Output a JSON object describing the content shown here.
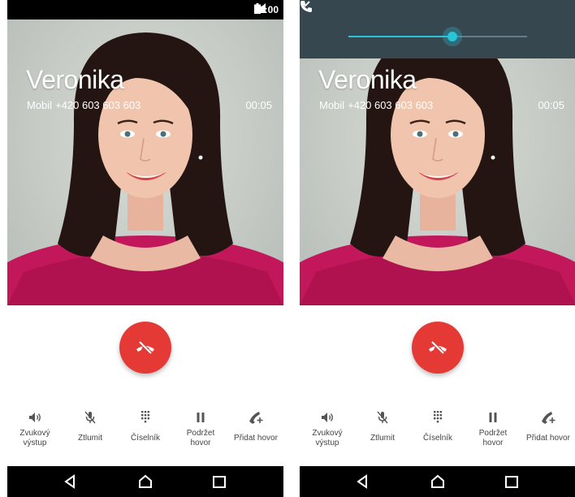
{
  "screens": [
    {
      "status_bar": {
        "time": "11:00"
      },
      "caller": {
        "name": "Veronika",
        "number_label": "Mobil",
        "number": "+420 603 603 603",
        "duration": "00:05"
      },
      "actions": [
        {
          "label_line1": "Zvukový",
          "label_line2": "výstup",
          "icon": "speaker-icon"
        },
        {
          "label_line1": "Ztlumit",
          "label_line2": "",
          "icon": "mic-off-icon"
        },
        {
          "label_line1": "Číselník",
          "label_line2": "",
          "icon": "dialpad-icon"
        },
        {
          "label_line1": "Podržet",
          "label_line2": "hovor",
          "icon": "pause-icon"
        },
        {
          "label_line1": "Přidat hovor",
          "label_line2": "",
          "icon": "add-call-icon"
        }
      ]
    },
    {
      "volume_panel": {
        "level": 0.58,
        "icon": "phone-icon",
        "expand_icon": "chevron-down-icon"
      },
      "caller": {
        "name": "Veronika",
        "number_label": "Mobil",
        "number": "+420 603 603 603",
        "duration": "00:05"
      },
      "actions": [
        {
          "label_line1": "Zvukový",
          "label_line2": "výstup",
          "icon": "speaker-icon"
        },
        {
          "label_line1": "Ztlumit",
          "label_line2": "",
          "icon": "mic-off-icon"
        },
        {
          "label_line1": "Číselník",
          "label_line2": "",
          "icon": "dialpad-icon"
        },
        {
          "label_line1": "Podržet",
          "label_line2": "hovor",
          "icon": "pause-icon"
        },
        {
          "label_line1": "Přidat hovor",
          "label_line2": "",
          "icon": "add-call-icon"
        }
      ]
    }
  ],
  "colors": {
    "end_call": "#e53935",
    "volume_panel": "#37474f",
    "volume_accent": "#26c6da",
    "navbar": "#000000"
  }
}
